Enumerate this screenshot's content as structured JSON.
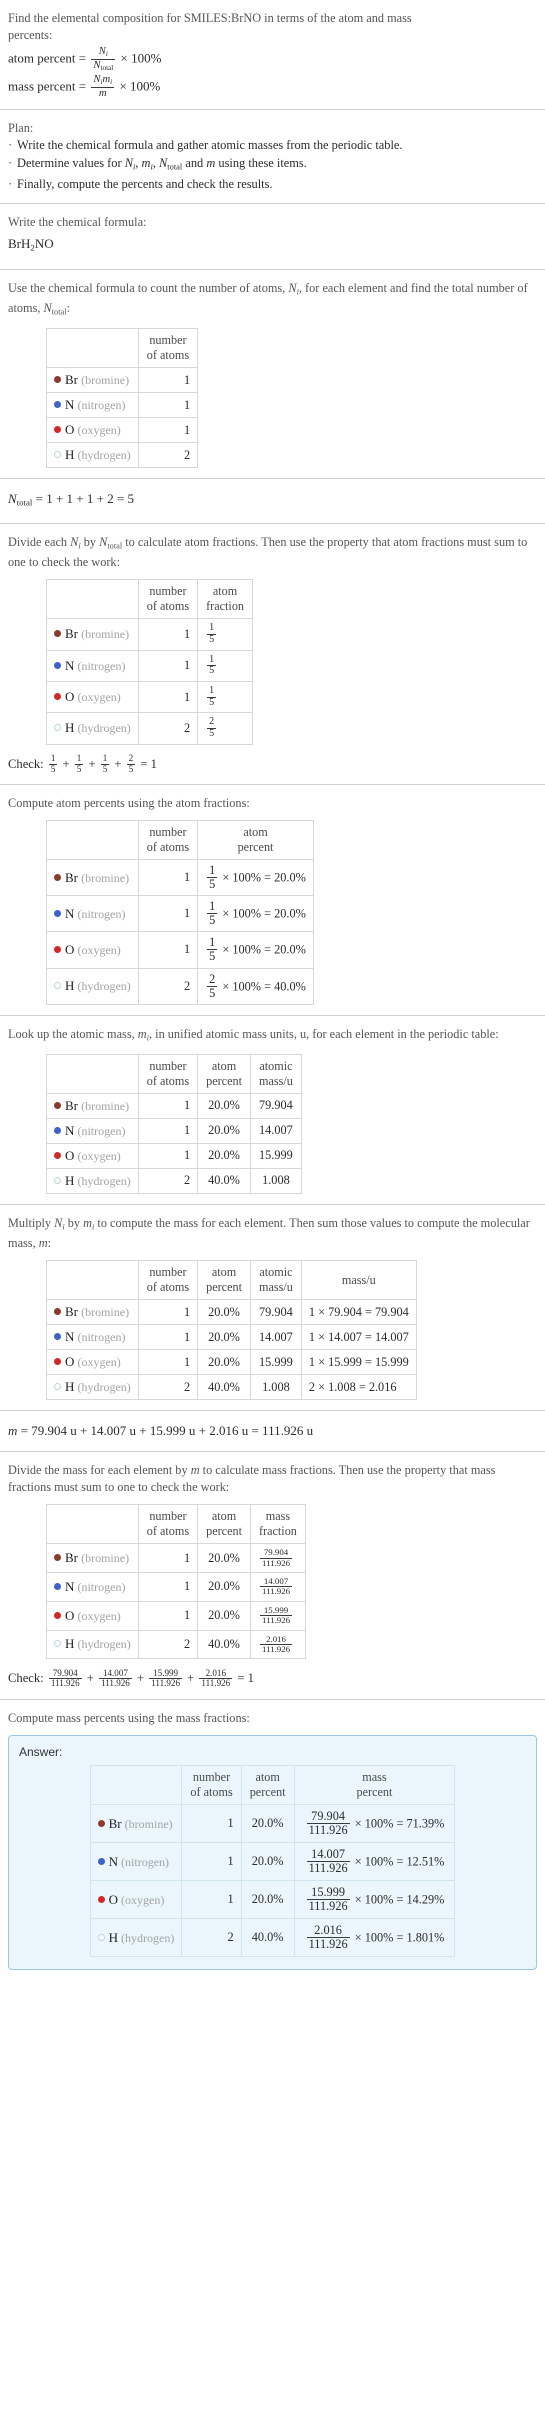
{
  "problem": {
    "statement_line1": "Find the elemental composition for SMILES:BrNO in terms of the atom and mass",
    "statement_line2": "percents:",
    "atom_percent_label": "atom percent =",
    "mass_percent_label": "mass percent =",
    "times_100": "× 100%",
    "N_i": "N",
    "N_i_sub": "i",
    "N_total": "N",
    "N_total_sub": "total",
    "m_i": "m",
    "m_i_sub": "i",
    "m": "m"
  },
  "plan": {
    "heading": "Plan:",
    "bullets": [
      "Write the chemical formula and gather atomic masses from the periodic table.",
      "Determine values for Nᵢ, mᵢ, Nₜₒₜₐₗ and m using these items.",
      "Finally, compute the percents and check the results."
    ],
    "bullet2_parts": {
      "pre": "Determine values for ",
      "mid": " and ",
      "post": " using these items."
    }
  },
  "steps": {
    "write_formula": {
      "instruction": "Write the chemical formula:",
      "formula_parts": [
        "BrH",
        "2",
        "NO"
      ]
    },
    "count_atoms": {
      "instruction_line1": "Use the chemical formula to count the number of atoms, Nᵢ, for each element",
      "instruction_line2": "and find the total number of atoms, Nₜₒₜₐₗ:",
      "instruction_pre": "Use the chemical formula to count the number of atoms, ",
      "instruction_mid": ", for each element and find the total number of atoms, ",
      "instruction_post": ":",
      "total_equation": "= 1 + 1 + 1 + 2 = 5"
    },
    "atom_fractions": {
      "instruction": "Divide each Nᵢ by Nₜₒₜₐₗ to calculate atom fractions. Then use the property that atom fractions must sum to one to check the work:",
      "instruction_pre": "Divide each ",
      "instruction_mid": " by ",
      "instruction_post": " to calculate atom fractions. Then use the property that atom fractions must sum to one to check the work:",
      "check_label": "Check:",
      "check_result": "= 1"
    },
    "atom_percents": {
      "instruction": "Compute atom percents using the atom fractions:"
    },
    "atomic_masses": {
      "instruction_line1": "Look up the atomic mass, mᵢ, in unified atomic mass units, u, for each element in",
      "instruction_line2": "the periodic table:",
      "instruction_pre": "Look up the atomic mass, ",
      "instruction_post": ", in unified atomic mass units, u, for each element in the periodic table:"
    },
    "molecular_mass": {
      "instruction_pre": "Multiply ",
      "instruction_mid": " by ",
      "instruction_post": " to compute the mass for each element. Then sum those values to compute the molecular mass, ",
      "instruction_end": ":",
      "equation": "= 79.904 u + 14.007 u + 15.999 u + 2.016 u = 111.926 u"
    },
    "mass_fractions": {
      "instruction_pre": "Divide the mass for each element by ",
      "instruction_post": " to calculate mass fractions. Then use the property that mass fractions must sum to one to check the work:",
      "check_label": "Check:",
      "check_result": "= 1"
    },
    "mass_percents": {
      "instruction": "Compute mass percents using the mass fractions:",
      "answer_label": "Answer:"
    }
  },
  "headers": {
    "number_of_atoms": [
      "number",
      "of atoms"
    ],
    "atom_fraction": [
      "atom",
      "fraction"
    ],
    "atom_percent": [
      "atom",
      "percent"
    ],
    "atomic_mass_u": [
      "atomic",
      "mass/u"
    ],
    "mass_u": "mass/u",
    "mass_fraction": [
      "mass",
      "fraction"
    ],
    "mass_percent": [
      "mass",
      "percent"
    ]
  },
  "elements": [
    {
      "symbol": "Br",
      "name": "(bromine)",
      "color": "#8b3a2e",
      "filled": true,
      "count": "1",
      "atom_fraction_num": "1",
      "atom_fraction_den": "5",
      "atom_percent_expr_tail": "× 100% = 20.0%",
      "atom_percent": "20.0%",
      "atomic_mass": "79.904",
      "mass_expr": "1 × 79.904 = 79.904",
      "mass_fraction_num": "79.904",
      "mass_fraction_den": "111.926",
      "mass_percent_tail": "× 100% = 71.39%",
      "mass_percent": "71.39%"
    },
    {
      "symbol": "N",
      "name": "(nitrogen)",
      "color": "#3f63c4",
      "filled": true,
      "count": "1",
      "atom_fraction_num": "1",
      "atom_fraction_den": "5",
      "atom_percent_expr_tail": "× 100% = 20.0%",
      "atom_percent": "20.0%",
      "atomic_mass": "14.007",
      "mass_expr": "1 × 14.007 = 14.007",
      "mass_fraction_num": "14.007",
      "mass_fraction_den": "111.926",
      "mass_percent_tail": "× 100% = 12.51%",
      "mass_percent": "12.51%"
    },
    {
      "symbol": "O",
      "name": "(oxygen)",
      "color": "#cf2a27",
      "filled": true,
      "count": "1",
      "atom_fraction_num": "1",
      "atom_fraction_den": "5",
      "atom_percent_expr_tail": "× 100% = 20.0%",
      "atom_percent": "20.0%",
      "atomic_mass": "15.999",
      "mass_expr": "1 × 15.999 = 15.999",
      "mass_fraction_num": "15.999",
      "mass_fraction_den": "111.926",
      "mass_percent_tail": "× 100% = 14.29%",
      "mass_percent": "14.29%"
    },
    {
      "symbol": "H",
      "name": "(hydrogen)",
      "color": "#ffffff",
      "border_color": "#bcd4dc",
      "filled": false,
      "count": "2",
      "atom_fraction_num": "2",
      "atom_fraction_den": "5",
      "atom_percent_expr_tail": "× 100% = 40.0%",
      "atom_percent": "40.0%",
      "atomic_mass": "1.008",
      "mass_expr": "2 × 1.008 = 2.016",
      "mass_fraction_num": "2.016",
      "mass_fraction_den": "111.926",
      "mass_percent_tail": "× 100% = 1.801%",
      "mass_percent": "1.801%"
    }
  ],
  "colors": {
    "rule": "#cfcfcf",
    "table_border": "#d8d8d8",
    "answer_border": "#9bc8e0",
    "answer_bg": "#eaf6fc",
    "text": "#2b2b2b",
    "muted": "#555555",
    "elname": "#a3a3a3"
  }
}
